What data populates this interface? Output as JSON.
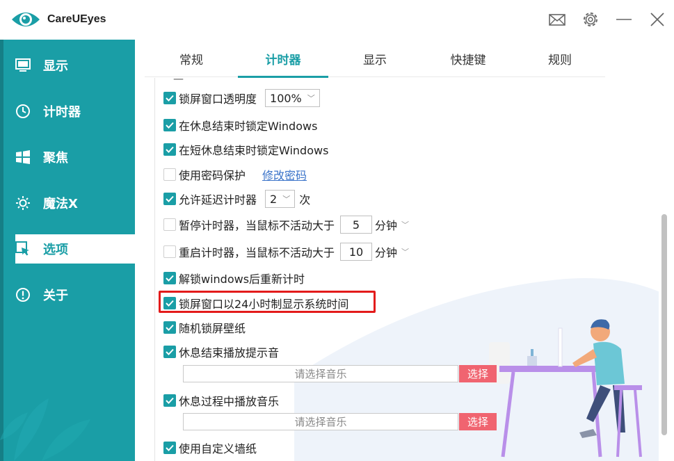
{
  "app": {
    "title": "CareUEyes"
  },
  "titlebar_icons": [
    "mail-icon",
    "gear-icon",
    "minimize-icon",
    "close-icon"
  ],
  "sidebar": {
    "items": [
      {
        "label": "显示",
        "icon": "monitor-icon"
      },
      {
        "label": "计时器",
        "icon": "clock-icon"
      },
      {
        "label": "聚焦",
        "icon": "windows-icon"
      },
      {
        "label": "魔法X",
        "icon": "sun-icon"
      },
      {
        "label": "选项",
        "icon": "cursor-icon",
        "active": true
      },
      {
        "label": "关于",
        "icon": "info-icon"
      }
    ]
  },
  "tabs": [
    {
      "label": "常规"
    },
    {
      "label": "计时器",
      "active": true
    },
    {
      "label": "显示"
    },
    {
      "label": "快捷键"
    },
    {
      "label": "规则"
    }
  ],
  "options": {
    "lock_opacity": {
      "label": "锁屏窗口透明度",
      "checked": true,
      "value": "100%"
    },
    "lock_after_break": {
      "label": "在休息结束时锁定Windows",
      "checked": true
    },
    "lock_after_short": {
      "label": "在短休息结束时锁定Windows",
      "checked": true
    },
    "password": {
      "label": "使用密码保护",
      "checked": false,
      "link": "修改密码"
    },
    "delay": {
      "label": "允许延迟计时器",
      "checked": true,
      "value": "2",
      "unit": "次"
    },
    "pause_idle": {
      "label": "暂停计时器，当鼠标不活动大于",
      "checked": false,
      "value": "5",
      "unit": "分钟"
    },
    "restart_idle": {
      "label": "重启计时器，当鼠标不活动大于",
      "checked": false,
      "value": "10",
      "unit": "分钟"
    },
    "reset_unlock": {
      "label": "解锁windows后重新计时",
      "checked": true
    },
    "clock24": {
      "label": "锁屏窗口以24小时制显示系统时间",
      "checked": true
    },
    "random_wallpaper": {
      "label": "随机锁屏壁纸",
      "checked": true
    },
    "end_sound": {
      "label": "休息结束播放提示音",
      "checked": true,
      "placeholder": "请选择音乐",
      "button": "选择"
    },
    "break_music": {
      "label": "休息过程中播放音乐",
      "checked": true,
      "placeholder": "请选择音乐",
      "button": "选择"
    },
    "custom_wallpaper": {
      "label": "使用自定义墙纸",
      "checked": true
    }
  },
  "colors": {
    "accent": "#1a9ea6",
    "highlight": "#e31b1b",
    "pick_button": "#f06470",
    "link": "#3a73c9"
  }
}
